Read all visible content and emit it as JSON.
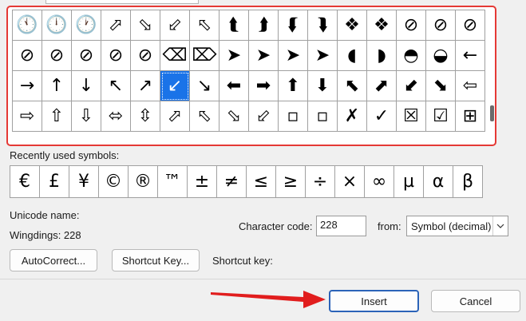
{
  "symbol_grid": {
    "selected_index": 37,
    "cells": [
      "🕚",
      "🕛",
      "🕐",
      "⬀",
      "⬂",
      "⬃",
      "⬁",
      "⮬",
      "⮭",
      "⮮",
      "⮯",
      "❖",
      "❖",
      "⊘",
      "⊘",
      "⊘",
      "⊘",
      "⊘",
      "⊘",
      "⊘",
      "⊘",
      "⌫",
      "⌦",
      "➤",
      "➤",
      "➤",
      "➤",
      "◖",
      "◗",
      "◓",
      "◒",
      "←",
      "→",
      "↑",
      "↓",
      "↖",
      "↗",
      "↙",
      "↘",
      "⬅",
      "➡",
      "⬆",
      "⬇",
      "⬉",
      "⬈",
      "⬋",
      "⬊",
      "⇦",
      "⇨",
      "⇧",
      "⇩",
      "⬄",
      "⇳",
      "⬀",
      "⬁",
      "⬂",
      "⬃",
      "▫",
      "▫",
      "✗",
      "✓",
      "☒",
      "☑",
      "⊞"
    ]
  },
  "recent": {
    "label": "Recently used symbols:",
    "symbols": [
      "€",
      "£",
      "¥",
      "©",
      "®",
      "™",
      "±",
      "≠",
      "≤",
      "≥",
      "÷",
      "×",
      "∞",
      "µ",
      "α",
      "β"
    ]
  },
  "unicode_name_label": "Unicode name:",
  "symbol_name": "Wingdings: 228",
  "character_code": {
    "label": "Character code:",
    "value": "228"
  },
  "from": {
    "label": "from:",
    "value": "Symbol (decimal)"
  },
  "shortcut_key_label": "Shortcut key:",
  "buttons": {
    "autocorrect": "AutoCorrect...",
    "shortcut_key": "Shortcut Key...",
    "insert": "Insert",
    "cancel": "Cancel"
  }
}
